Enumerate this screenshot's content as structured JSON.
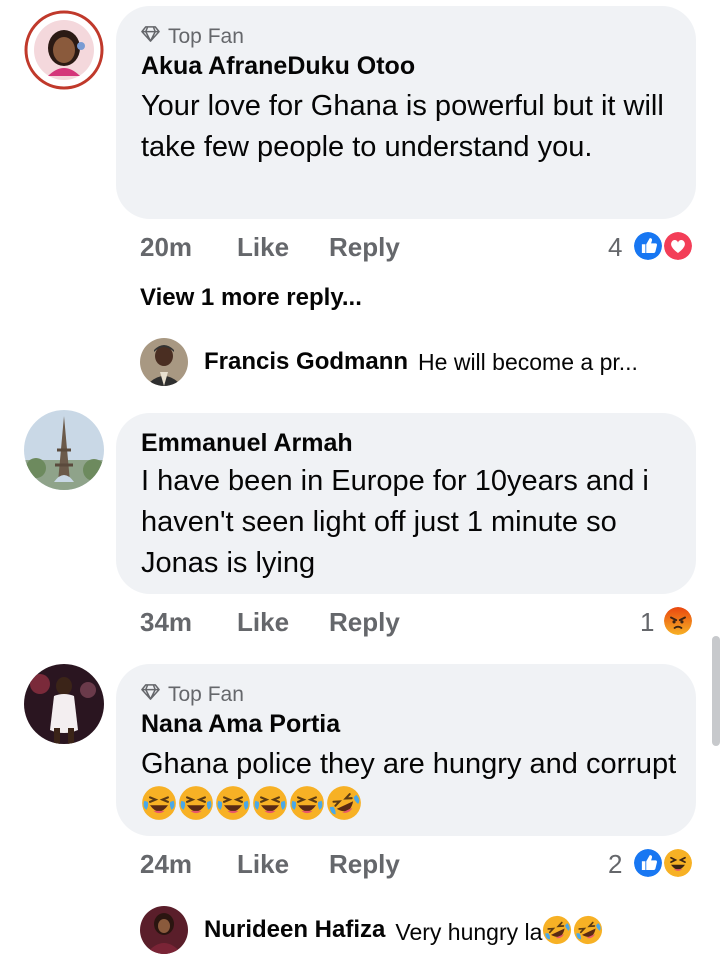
{
  "comments": [
    {
      "badge": "Top Fan",
      "author": "Akua AfraneDuku Otoo",
      "text": "Your love for Ghana is powerful but it will take few people to understand you.",
      "time": "20m",
      "like_label": "Like",
      "reply_label": "Reply",
      "reaction_count": "4",
      "reactions": [
        "like",
        "love"
      ],
      "view_more": "View 1 more reply...",
      "reply_preview": {
        "author": "Francis Godmann",
        "text": "He will become a pr..."
      }
    },
    {
      "author": "Emmanuel Armah",
      "text": "I have been in Europe for 10years and i haven't seen light off just 1 minute so Jonas is lying",
      "time": "34m",
      "like_label": "Like",
      "reply_label": "Reply",
      "reaction_count": "1",
      "reactions": [
        "angry"
      ]
    },
    {
      "badge": "Top Fan",
      "author": "Nana Ama Portia",
      "text": "Ghana police they are hungry and corrupt",
      "text_emojis": [
        "laughing-tears-emoji",
        "laughing-tears-emoji",
        "laughing-tears-emoji",
        "laughing-tears-emoji",
        "laughing-tears-emoji",
        "rolling-laughing-emoji"
      ],
      "time": "24m",
      "like_label": "Like",
      "reply_label": "Reply",
      "reaction_count": "2",
      "reactions": [
        "like",
        "haha"
      ],
      "reply_preview": {
        "author": "Nurideen Hafiza",
        "text": "Very hungry la",
        "emojis": [
          "rolling-laughing-emoji",
          "rolling-laughing-emoji"
        ]
      }
    }
  ],
  "colors": {
    "bubble": "#f0f2f5",
    "secondary_text": "#65676b",
    "like_blue": "#1877f2",
    "love_red": "#f33e58",
    "angry_orange": "#e9710f",
    "haha_yellow": "#f7b125"
  }
}
